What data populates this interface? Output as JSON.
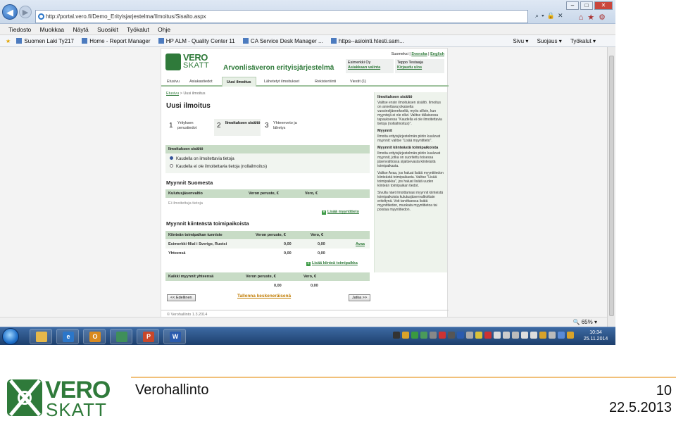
{
  "browser": {
    "url": "http://portal.vero.fi/Demo_Erityisjarjestelma/Ilmoitus/Sisalto.aspx",
    "menu": [
      "Tiedosto",
      "Muokkaa",
      "Näytä",
      "Suosikit",
      "Työkalut",
      "Ohje"
    ],
    "favorites": [
      "Suomen Laki Ty217",
      "Home - Report Manager",
      "HP ALM - Quality Center 11",
      "CA Service Desk Manager ...",
      "https--asiointi.htesti.sam..."
    ],
    "favbar_right": [
      "Sivu ▾",
      "Suojaus ▾",
      "Työkalut ▾"
    ],
    "zoom": "65%"
  },
  "site": {
    "logo_top": "VERO",
    "logo_bottom": "SKATT",
    "system_name": "Arvonlisäveron erityisjärjestelmä",
    "lang_prefix": "Suomeksi |",
    "lang_sv": "Svenska",
    "lang_sep": "|",
    "lang_en": "English",
    "company": "Esimerkki Oy",
    "company_link": "Asiakkaan valinta",
    "user": "Teppo Testaaja",
    "logout": "Kirjaudu ulos",
    "tabs": [
      "Etusivu",
      "Asiakastiedot",
      "Uusi ilmoitus",
      "Lähetetyt ilmoitukset",
      "Rekisteröinti",
      "Viestit (1)"
    ],
    "breadcrumb_home": "Etusivu",
    "breadcrumb_current": "> Uusi ilmoitus",
    "page_title": "Uusi ilmoitus",
    "steps": [
      {
        "num": "1",
        "label": "Yrityksen perustiedot"
      },
      {
        "num": "2",
        "label": "Ilmoituksen sisältö"
      },
      {
        "num": "3",
        "label": "Yhteenveto ja lähetys"
      }
    ],
    "content_head": "Ilmoituksen sisältö",
    "radio1": "Kaudella on ilmoitettavia tietoja",
    "radio2": "Kaudella ei ole ilmoitettavia tietoja (nollailmoitus)",
    "sales_fi_title": "Myynnit Suomesta",
    "sales_fi_cols": [
      "Kulutusjäsenvaltio",
      "Veron peruste, €",
      "Vero, €"
    ],
    "sales_fi_empty": "Ei ilmoitettuja tietoja",
    "add_sale": "Lisää myyntitieto",
    "sales_fixed_title": "Myynnit kiinteästä toimipaikoista",
    "sales_fixed_cols": [
      "Kiinteän toimipaikan tunniste",
      "Veron peruste, €",
      "Vero, €"
    ],
    "sales_fixed_row": {
      "name": "Esimerkki filial i Sverige, Ruotsi",
      "base": "0,00",
      "tax": "0,00",
      "action": "Avaa"
    },
    "sales_fixed_total": {
      "name": "Yhteensä",
      "base": "0,00",
      "tax": "0,00"
    },
    "add_fixed": "Lisää kiinteä toimipaikka",
    "all_cols": [
      "Kaikki myynnit yhteensä",
      "Veron peruste, €",
      "Vero, €"
    ],
    "all_total": {
      "base": "0,00",
      "tax": "0,00"
    },
    "btn_prev": "<< Edellinen",
    "save_draft": "Tallenna keskeneräisenä",
    "btn_next": "Jatka >>",
    "footer": "© Verohallinto 1.3.2014",
    "help": [
      {
        "head": "Ilmoituksen sisältö",
        "text": "Valitse ensin ilmoituksen sisältö. Ilmoitus on annettava jokaiselta vuosineljännekseltä, myös silloin, kun myyntejä ei ole ollut. Valitse tällaisessa tapauksessa \"Kaudella ei ole ilmoitettavia tietoja (nollailmoitus)\"."
      },
      {
        "head": "Myynnit",
        "text": "Ilmoita erityisjärjestelmän piiriin kuuluvat myynnit: valitse \"Lisää myyntitieto\"."
      },
      {
        "head": "Myynnit kiinteästä toimipaikoista",
        "text": "Ilmoita erityisjärjestelmän piiriin kuuluvat myynnit, jotka on suoritettu toisessa jäsenvaltiossa sijaitsevasta kiinteästä toimipaikasta."
      },
      {
        "head": "",
        "text": "Valitse Avaa, jos haluat lisätä myyntitiedon kiinteästä toimipaikasta. Valitse \"Lisää toimipaikka\", jos haluat lisätä uuden kiinteän toimipaikan tiedot."
      },
      {
        "head": "",
        "text": "Sivulla näet ilmoittamasi myynnit kiinteistä toimipaikoista kulutusjäsenvaltioittain eriteltynä. Voit tarvittaessa lisätä myyntitiedon, muokata myyntitietoa tai poistaa myyntitiedon."
      }
    ]
  },
  "taskbar": {
    "time": "10:34",
    "date": "25.11.2014"
  },
  "slide": {
    "logo_top": "VERO",
    "logo_bottom": "SKATT",
    "org": "Verohallinto",
    "page": "10",
    "date": "22.5.2013"
  },
  "colors": {
    "brand_green": "#2f7a3a",
    "panel_green": "#c8dcc6",
    "accent_orange": "#c07b00"
  }
}
